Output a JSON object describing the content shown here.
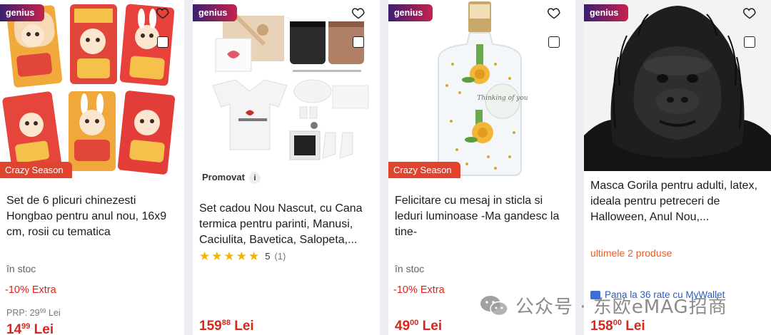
{
  "badges": {
    "genius": "genius",
    "crazy_season": "Crazy Season",
    "promovat": "Promovat",
    "info": "i"
  },
  "colors": {
    "price_red": "#d9261c",
    "genius_start": "#3a1f6e",
    "genius_end": "#c7224f",
    "crazy_orange": "#e0442f",
    "star_gold": "#f5b400",
    "wallet_blue": "#2c5cc5"
  },
  "icons": {
    "favorite": "heart-icon",
    "compare": "compare-checkbox-icon",
    "rating": "star-icon",
    "wallet": "wallet-icon",
    "watermark": "wechat-icon"
  },
  "products": [
    {
      "title": "Set de 6 plicuri chinezesti Hongbao pentru anul nou, 16x9 cm, rosii cu tematica",
      "stock": "în stoc",
      "extra": "-10% Extra",
      "prp_label": "PRP: 29",
      "prp_dec": "99",
      "prp_cur": "Lei",
      "price_int": "14",
      "price_dec": "99",
      "price_cur": "Lei"
    },
    {
      "title": "Set cadou Nou Nascut, cu Cana termica pentru parinti, Manusi, Caciulita, Bavetica, Salopeta,...",
      "rating": "5",
      "rating_count": "(1)",
      "rating_stars": 5,
      "price_int": "159",
      "price_dec": "88",
      "price_cur": "Lei"
    },
    {
      "title": "Felicitare cu mesaj in sticla si leduri luminoase -Ma gandesc la tine-",
      "bottle_text": "Thinking of you",
      "stock": "în stoc",
      "extra": "-10% Extra",
      "price_int": "49",
      "price_dec": "00",
      "price_cur": "Lei"
    },
    {
      "title": "Masca Gorila pentru adulti, latex, ideala pentru petreceri de Halloween, Anul Nou,...",
      "stock_warning": "ultimele 2 produse",
      "installments": "Pana la 36 rate cu MyWallet",
      "price_int": "158",
      "price_dec": "00",
      "price_cur": "Lei"
    }
  ],
  "watermark": "公众号 · 东欧eMAG招商"
}
